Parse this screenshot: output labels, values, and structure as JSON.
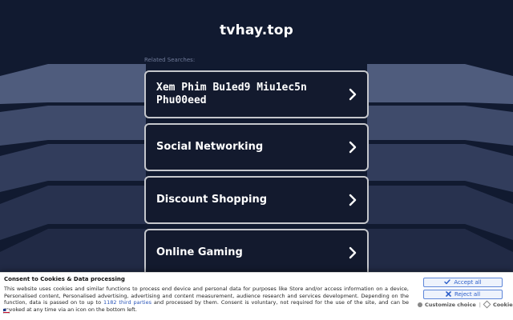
{
  "header": {
    "site_title": "tvhay.top",
    "related_label": "Related Searches:"
  },
  "results": [
    {
      "label": "Xem Phim Bu1ed9 Miu1ec5n Phu00eed",
      "icon": "chevron-right-icon"
    },
    {
      "label": "Social Networking",
      "icon": "chevron-right-icon"
    },
    {
      "label": "Discount Shopping",
      "icon": "chevron-right-icon"
    },
    {
      "label": "Online Gaming",
      "icon": "chevron-right-icon"
    }
  ],
  "cookie_banner": {
    "title": "Consent to Cookies & Data processing",
    "text_before_link": "This website uses cookies and similar functions to process end device and personal data for purposes like Store and/or access information on a device, Personalised content, Personalised advertising, advertising and content measurement, audience research and services development. Depending on the function, data is passed on to up to ",
    "link_text": "1182 third parties",
    "text_after_link": " and processed by them. Consent is voluntary, not required for the use of the site, and can be revoked at any time via an icon on the bottom left.",
    "accept_label": "Accept all",
    "reject_label": "Reject all",
    "customize_label": "Customize choice",
    "separator": "|",
    "cookies_label": "Cookies"
  },
  "colors": {
    "background": "#111a30",
    "card_background": "#131a2e",
    "card_border": "#c5c7cc",
    "accent_blue": "#2d5fc9"
  }
}
